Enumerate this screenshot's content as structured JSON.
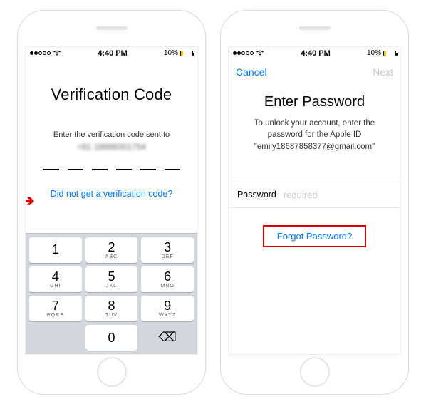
{
  "statusbar": {
    "time": "4:40 PM",
    "battery": "10%"
  },
  "left": {
    "title": "Verification Code",
    "subtitle": "Enter the verification code sent to",
    "phoneNumberMasked": "+81 18688301754",
    "resendLink": "Did not get a verification code?",
    "keypad": {
      "keys": [
        {
          "num": "1",
          "let": ""
        },
        {
          "num": "2",
          "let": "ABC"
        },
        {
          "num": "3",
          "let": "DEF"
        },
        {
          "num": "4",
          "let": "GHI"
        },
        {
          "num": "5",
          "let": "JKL"
        },
        {
          "num": "6",
          "let": "MNO"
        },
        {
          "num": "7",
          "let": "PQRS"
        },
        {
          "num": "8",
          "let": "TUV"
        },
        {
          "num": "9",
          "let": "WXYZ"
        }
      ],
      "zero": "0"
    }
  },
  "right": {
    "nav": {
      "cancel": "Cancel",
      "next": "Next"
    },
    "title": "Enter Password",
    "description": "To unlock your account, enter the password for the Apple ID \"emily18687858377@gmail.com\"",
    "passwordLabel": "Password",
    "passwordPlaceholder": "required",
    "forgot": "Forgot Password?"
  }
}
